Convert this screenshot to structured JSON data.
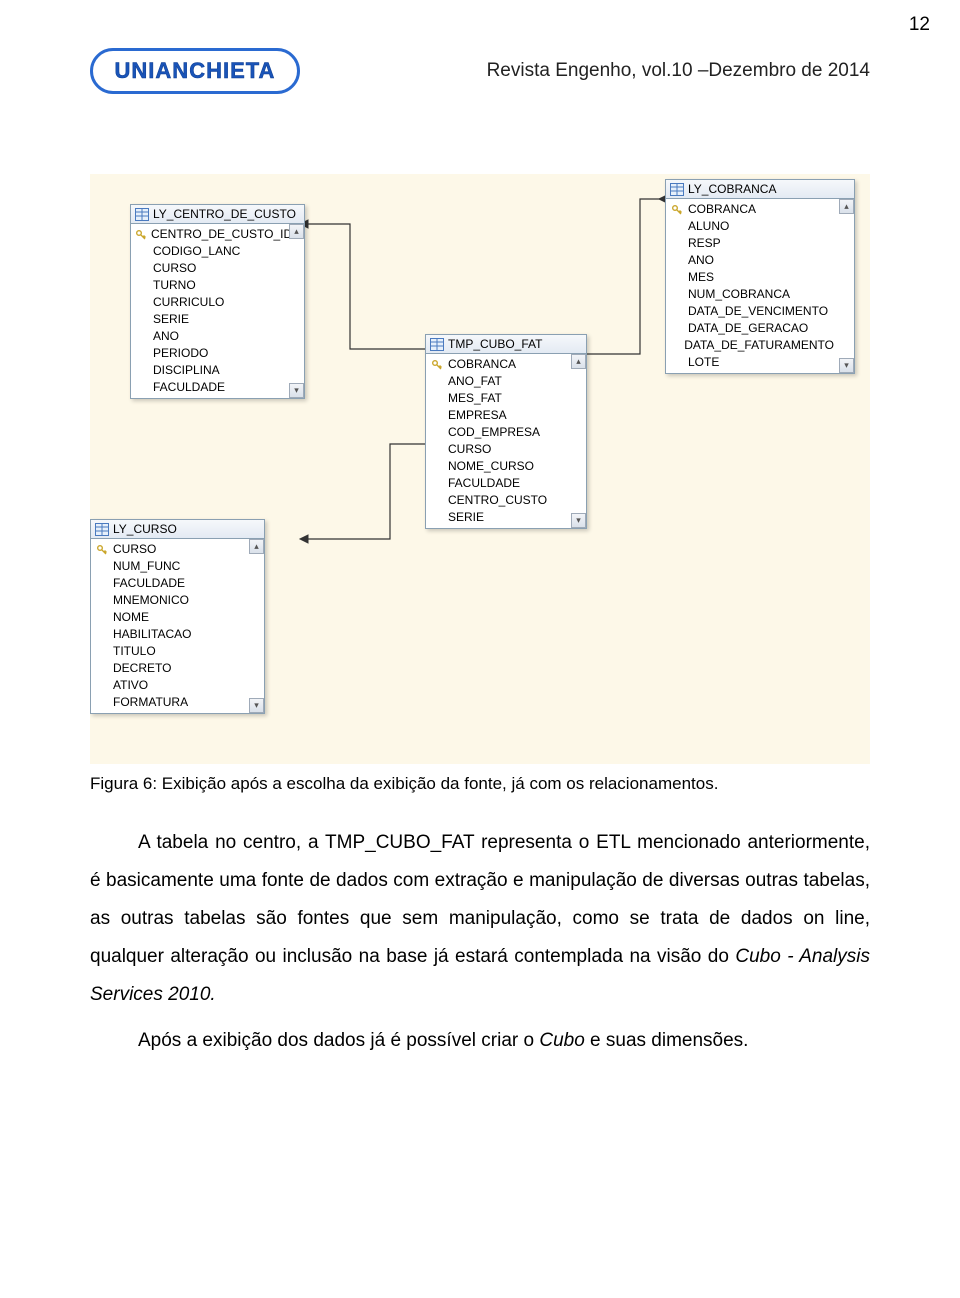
{
  "page_number": "12",
  "journal_title": "Revista Engenho, vol.10 –Dezembro de 2014",
  "brand": "UNIANCHIETA",
  "caption": "Figura 6: Exibição após a escolha da exibição da fonte, já com os relacionamentos.",
  "para1": "A tabela no centro, a TMP_CUBO_FAT representa o ETL mencionado anteriormente, é basicamente uma fonte de dados com extração e manipulação de diversas outras tabelas, as outras tabelas são fontes que sem manipulação, como se trata de dados on line, qualquer alteração ou inclusão na base já estará contemplada na visão do ",
  "para1_ital": "Cubo - Analysis Services 2010.",
  "para2_a": "Após a exibição dos dados já é possível criar o ",
  "para2_b": "Cubo",
  "para2_c": " e suas dimensões.",
  "tables": {
    "t1": {
      "title": "LY_CENTRO_DE_CUSTO",
      "cols": [
        "CENTRO_DE_CUSTO_ID",
        "CODIGO_LANC",
        "CURSO",
        "TURNO",
        "CURRICULO",
        "SERIE",
        "ANO",
        "PERIODO",
        "DISCIPLINA",
        "FACULDADE"
      ],
      "keys": [
        true,
        false,
        false,
        false,
        false,
        false,
        false,
        false,
        false,
        false
      ]
    },
    "t2": {
      "title": "TMP_CUBO_FAT",
      "cols": [
        "COBRANCA",
        "ANO_FAT",
        "MES_FAT",
        "EMPRESA",
        "COD_EMPRESA",
        "CURSO",
        "NOME_CURSO",
        "FACULDADE",
        "CENTRO_CUSTO",
        "SERIE"
      ],
      "keys": [
        true,
        false,
        false,
        false,
        false,
        false,
        false,
        false,
        false,
        false
      ]
    },
    "t3": {
      "title": "LY_COBRANCA",
      "cols": [
        "COBRANCA",
        "ALUNO",
        "RESP",
        "ANO",
        "MES",
        "NUM_COBRANCA",
        "DATA_DE_VENCIMENTO",
        "DATA_DE_GERACAO",
        "DATA_DE_FATURAMENTO",
        "LOTE"
      ],
      "keys": [
        true,
        false,
        false,
        false,
        false,
        false,
        false,
        false,
        false,
        false
      ]
    },
    "t4": {
      "title": "LY_CURSO",
      "cols": [
        "CURSO",
        "NUM_FUNC",
        "FACULDADE",
        "MNEMONICO",
        "NOME",
        "HABILITACAO",
        "TITULO",
        "DECRETO",
        "ATIVO",
        "FORMATURA"
      ],
      "keys": [
        true,
        false,
        false,
        false,
        false,
        false,
        false,
        false,
        false,
        false
      ]
    }
  }
}
